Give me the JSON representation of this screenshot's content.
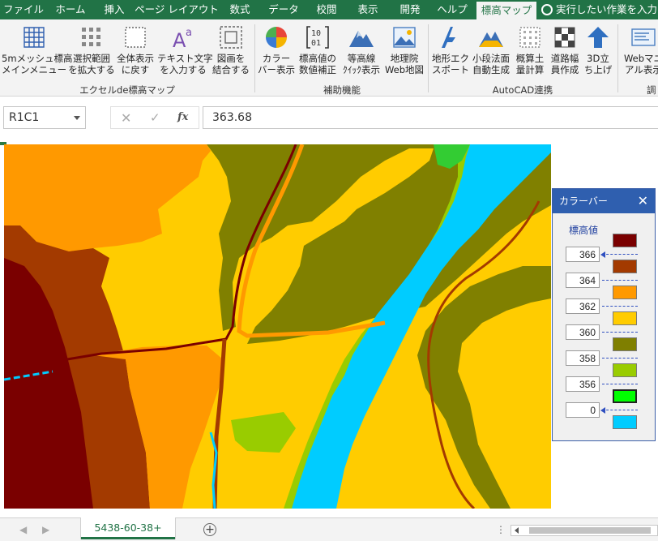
{
  "ribbon_tabs": [
    {
      "label": "ファイル"
    },
    {
      "label": "ホーム"
    },
    {
      "label": "挿入"
    },
    {
      "label": "ページ レイアウト"
    },
    {
      "label": "数式"
    },
    {
      "label": "データ"
    },
    {
      "label": "校閲"
    },
    {
      "label": "表示"
    },
    {
      "label": "開発"
    },
    {
      "label": "ヘルプ"
    },
    {
      "label": "標高マップ"
    }
  ],
  "tell_me": "実行したい作業を入力",
  "groups": [
    {
      "label": "エクセルde標高マップ",
      "buttons": [
        {
          "line1": "5mメッシュ標高",
          "line2": "メインメニュー",
          "icon": "grid-icon"
        },
        {
          "line1": "選択範囲",
          "line2": "を拡大する",
          "icon": "dotted-grid-icon"
        },
        {
          "line1": "全体表示",
          "line2": "に戻す",
          "icon": "full-view-icon"
        },
        {
          "line1": "テキスト文字",
          "line2": "を入力する",
          "icon": "text-aa-icon"
        },
        {
          "line1": "図画を",
          "line2": "結合する",
          "icon": "combine-icon"
        }
      ]
    },
    {
      "label": "補助機能",
      "buttons": [
        {
          "line1": "カラー",
          "line2": "バー表示",
          "icon": "pie-chart-icon"
        },
        {
          "line1": "標高値の",
          "line2": "数値補正",
          "icon": "binary-bracket-icon"
        },
        {
          "line1": "等高線",
          "line2": "ｸｲｯｸ表示",
          "icon": "mountain-icon"
        },
        {
          "line1": "地理院",
          "line2": "Web地図",
          "icon": "map-picture-icon"
        }
      ]
    },
    {
      "label": "AutoCAD連携",
      "buttons": [
        {
          "line1": "地形エク",
          "line2": "スポート",
          "icon": "autocad-a-icon"
        },
        {
          "line1": "小段法面",
          "line2": "自動生成",
          "icon": "slope-mountain-icon"
        },
        {
          "line1": "概算土",
          "line2": "量計算",
          "icon": "earthwork-grid-icon"
        },
        {
          "line1": "道路幅",
          "line2": "員作成",
          "icon": "checker-icon"
        },
        {
          "line1": "3D立",
          "line2": "ち上げ",
          "icon": "up-arrow-icon"
        }
      ]
    },
    {
      "label": "調",
      "buttons": [
        {
          "line1": "Webマニ",
          "line2": "アル表示",
          "icon": "web-manual-icon"
        }
      ]
    }
  ],
  "formula_bar": {
    "name_box": "R1C1",
    "cancel_glyph": "✕",
    "enter_glyph": "✓",
    "fx_glyph": "fx",
    "value": "363.68"
  },
  "color_bar": {
    "title": "カラーバー",
    "close_glyph": "✕",
    "header": "標高値",
    "values": [
      "366",
      "364",
      "362",
      "360",
      "358",
      "356",
      "0"
    ],
    "swatches": [
      "#7a0000",
      "#a33a00",
      "#ff9900",
      "#ffcc00",
      "#7f7f00",
      "#99cc00",
      "#00ff00",
      "#00ccff"
    ]
  },
  "map_palette": {
    "darkred": "#7a0000",
    "brown": "#a33a00",
    "orange": "#ff9900",
    "gold": "#ffcc00",
    "olive": "#808000",
    "lime": "#99cc00",
    "green": "#33cc33",
    "cyan": "#00ccff"
  },
  "sheet_bar": {
    "prev_glyph": "◀",
    "next_glyph": "▶",
    "active_sheet": "5438-60-38+",
    "add_glyph": "+",
    "more_glyph": "⋮"
  },
  "accent": "#217346"
}
